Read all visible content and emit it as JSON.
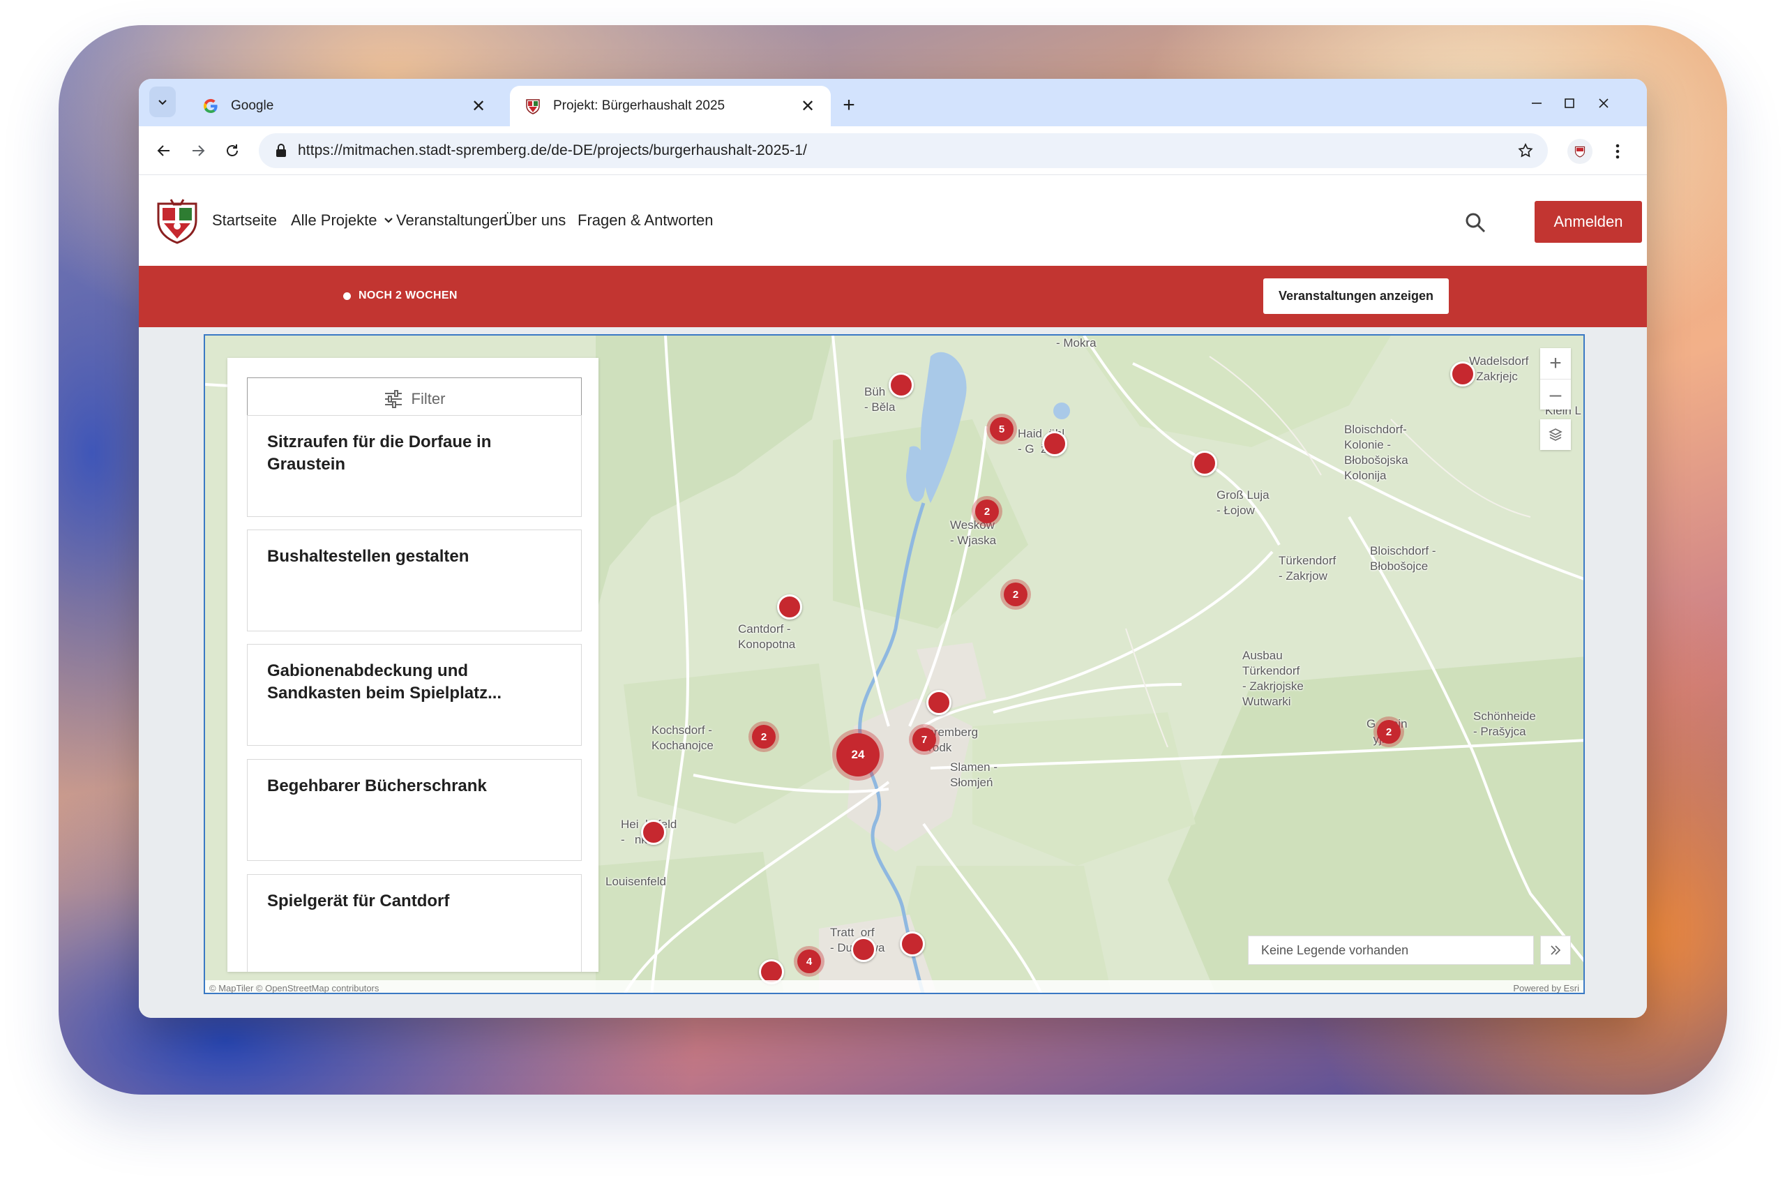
{
  "browser": {
    "tabs": [
      {
        "title": "Google",
        "active": false,
        "favicon": "google-g-icon"
      },
      {
        "title": "Projekt: Bürgerhaushalt 2025",
        "active": true,
        "favicon": "spremberg-crest-icon"
      }
    ],
    "url": "https://mitmachen.stadt-spremberg.de/de-DE/projects/burgerhaushalt-2025-1/"
  },
  "site": {
    "nav": {
      "home": "Startseite",
      "projects": "Alle Projekte",
      "events": "Veranstaltungen",
      "about": "Über uns",
      "faq": "Fragen & Antworten"
    },
    "login_label": "Anmelden",
    "accent_color": "#c23531"
  },
  "banner": {
    "status": "NOCH 2 WOCHEN",
    "events_button": "Veranstaltungen anzeigen"
  },
  "panel": {
    "filter_label": "Filter",
    "ideas": [
      {
        "title": "Sitzraufen für die Dorfaue in Graustein"
      },
      {
        "title": "Bushaltestellen gestalten"
      },
      {
        "title": "Gabionenabdeckung und Sandkasten beim Spielplatz..."
      },
      {
        "title": "Begehbarer Bücherschrank"
      },
      {
        "title": "Spielgerät für Cantdorf"
      }
    ]
  },
  "map": {
    "places": {
      "mokra": "- Mokra",
      "buehl": "Büh\n- Běla",
      "haidemuehl": "Haid  ühl\n- G  ž",
      "wadelsdorf": "Wadelsdorf\n- Zakrjejc",
      "klein_loitz": "Klein L",
      "bloischdorf_kolonie": "Bloischdorf-\nKolonie -\nBłobošojska\nKolonija",
      "gross_luja": "Groß Luja\n- Łojow",
      "weskow": "Weskow\n- Wjaska",
      "tuerkendorf": "Türkendorf\n- Zakrjow",
      "bloischdorf": "Bloischdorf -\nBłobošojce",
      "cantdorf": "Cantdorf -\nKonopotna",
      "ausbau_tuerkendorf": "Ausbau\nTürkendorf\n- Zakrjojske\nWutwarki",
      "kochsdorf": "Kochsdorf -\nKochanojce",
      "spremberg": "Spremberg\nGrodk",
      "slamen": "Slamen -\nSłomjeń",
      "graustein": "G  stein\n  yjk",
      "schoenheide": "Schönheide\n- Prašyjca",
      "heinrichsfeld": "Hei  hsfeld\n-   nki",
      "louisenfeld": "Louisenfeld",
      "trattendorf": "Tratt  orf\n- Dubrawa"
    },
    "clusters": [
      "5",
      "2",
      "2",
      "24",
      "7",
      "2",
      "2",
      "4"
    ],
    "legend_text": "Keine Legende vorhanden",
    "attribution": "© MapTiler © OpenStreetMap contributors",
    "powered_by": "Powered by Esri",
    "marker_color": "#c6282f"
  }
}
